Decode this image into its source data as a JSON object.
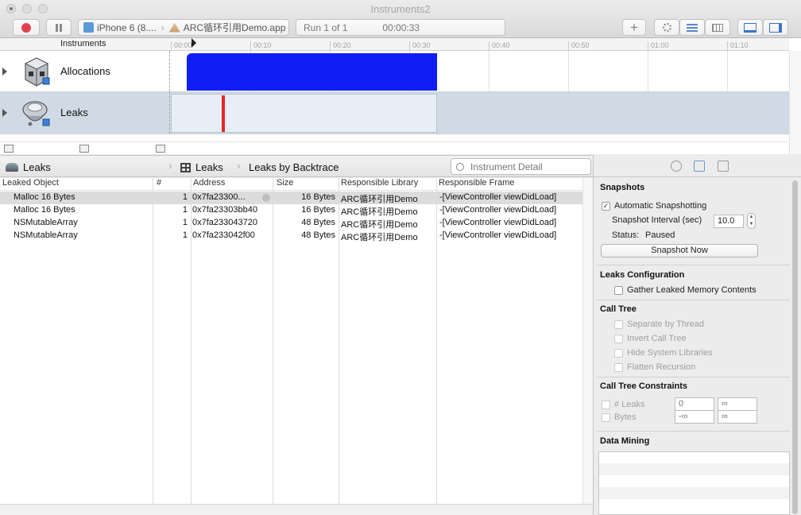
{
  "window": {
    "title": "Instruments2"
  },
  "toolbar": {
    "target_device": "iPhone 6 (8....",
    "target_app": "ARC循环引用Demo.app",
    "run_label": "Run 1 of 1",
    "run_time": "00:00:33"
  },
  "timeline": {
    "header_label": "Instruments",
    "ticks": [
      "00:00",
      "00:10",
      "00:20",
      "00:30",
      "00:40",
      "00:50",
      "01:00",
      "01:10"
    ],
    "tracks": [
      {
        "name": "Allocations"
      },
      {
        "name": "Leaks"
      }
    ]
  },
  "detail": {
    "instrument": "Leaks",
    "view": "Leaks",
    "mode": "Leaks by Backtrace",
    "search_placeholder": "Instrument Detail"
  },
  "table": {
    "columns": [
      "Leaked Object",
      "#",
      "Address",
      "Size",
      "Responsible Library",
      "Responsible Frame"
    ],
    "rows": [
      {
        "object": "Malloc 16 Bytes",
        "count": "1",
        "address": "0x7fa23300...",
        "size": "16 Bytes",
        "library": "ARC循环引用Demo",
        "frame": "-[ViewController viewDidLoad]"
      },
      {
        "object": "Malloc 16 Bytes",
        "count": "1",
        "address": "0x7fa23303bb40",
        "size": "16 Bytes",
        "library": "ARC循环引用Demo",
        "frame": "-[ViewController viewDidLoad]"
      },
      {
        "object": "NSMutableArray",
        "count": "1",
        "address": "0x7fa233043720",
        "size": "48 Bytes",
        "library": "ARC循环引用Demo",
        "frame": "-[ViewController viewDidLoad]"
      },
      {
        "object": "NSMutableArray",
        "count": "1",
        "address": "0x7fa233042f00",
        "size": "48 Bytes",
        "library": "ARC循环引用Demo",
        "frame": "-[ViewController viewDidLoad]"
      }
    ]
  },
  "inspector": {
    "snapshots": {
      "title": "Snapshots",
      "auto_label": "Automatic Snapshotting",
      "interval_label": "Snapshot Interval (sec)",
      "interval_value": "10.0",
      "status_label": "Status:",
      "status_value": "Paused",
      "button": "Snapshot Now"
    },
    "leaks_config": {
      "title": "Leaks Configuration",
      "gather_label": "Gather Leaked Memory Contents"
    },
    "call_tree": {
      "title": "Call Tree",
      "options": [
        "Separate by Thread",
        "Invert Call Tree",
        "Hide System Libraries",
        "Flatten Recursion"
      ]
    },
    "constraints": {
      "title": "Call Tree Constraints",
      "leaks_label": "# Leaks",
      "leaks_min": "0",
      "leaks_max": "∞",
      "bytes_label": "Bytes",
      "bytes_min": "-∞",
      "bytes_max": "∞"
    },
    "data_mining": {
      "title": "Data Mining"
    }
  },
  "colors": {
    "alloc_bar": "#0f1ef5",
    "leak_mark": "#e4262b",
    "record": "#e04250"
  }
}
